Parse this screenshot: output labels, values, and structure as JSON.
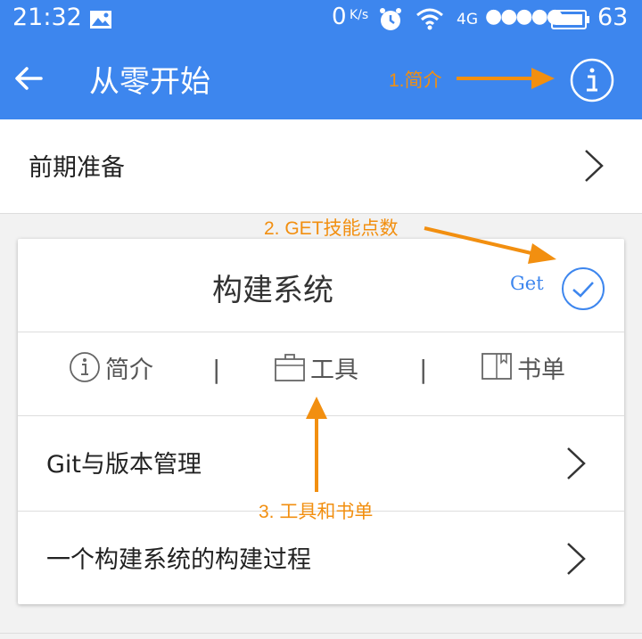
{
  "status_bar": {
    "time": "21:32",
    "speed": "0",
    "speed_unit": "K/s",
    "network": "4G",
    "signal": "●●●●●",
    "battery": "63"
  },
  "app_bar": {
    "title": "从零开始"
  },
  "section": {
    "label": "前期准备"
  },
  "card": {
    "title": "构建系统",
    "get_label": "Get",
    "tabs": [
      {
        "label": "简介",
        "icon": "info-icon"
      },
      {
        "label": "工具",
        "icon": "toolbox-icon"
      },
      {
        "label": "书单",
        "icon": "book-icon"
      }
    ],
    "tab_separator": "|",
    "items": [
      {
        "label": "Git与版本管理"
      },
      {
        "label": "一个构建系统的构建过程"
      }
    ]
  },
  "annotations": {
    "intro": "1.简介",
    "skill": "2. GET技能点数",
    "tools": "3. 工具和书单"
  },
  "colors": {
    "primary": "#3d86ee",
    "annotation": "#f28f10"
  }
}
